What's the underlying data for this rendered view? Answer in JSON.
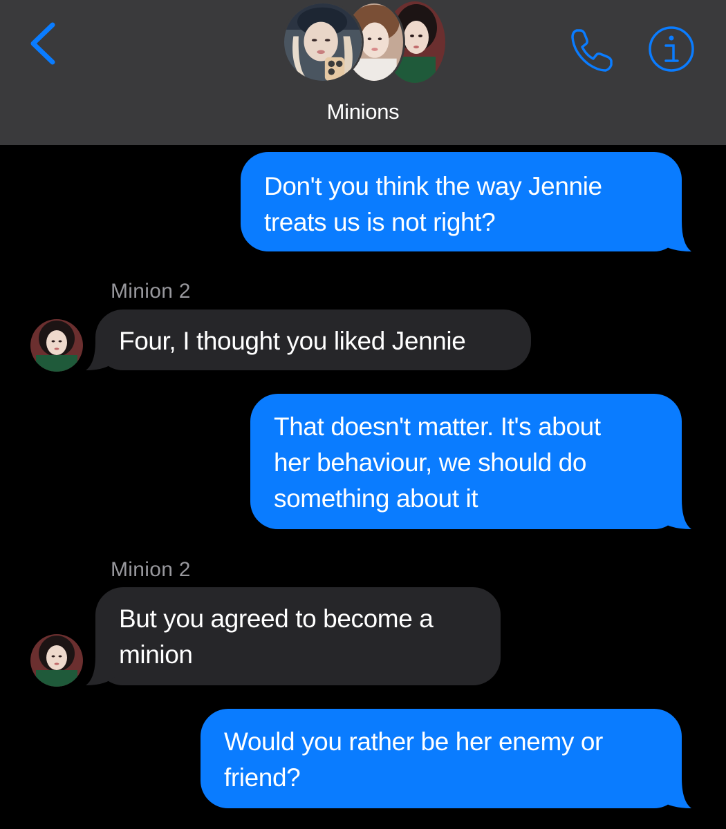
{
  "header": {
    "title": "Minions",
    "back_icon": "chevron-left-icon",
    "call_icon": "phone-icon",
    "info_icon": "info-icon",
    "accent_color": "#0a7cff"
  },
  "messages": [
    {
      "direction": "outgoing",
      "lines": [
        "Don't you think the way Jennie",
        "treats us is not right?"
      ]
    },
    {
      "direction": "incoming",
      "sender": "Minion 2",
      "lines": [
        "Four, I thought you liked Jennie"
      ]
    },
    {
      "direction": "outgoing",
      "lines": [
        "That doesn't matter. It's about",
        "her behaviour, we should do",
        "something about it"
      ]
    },
    {
      "direction": "incoming",
      "sender": "Minion 2",
      "lines": [
        "But you agreed to become a",
        "minion"
      ]
    },
    {
      "direction": "outgoing",
      "lines": [
        "Would you rather be her enemy or",
        "friend?"
      ]
    }
  ]
}
